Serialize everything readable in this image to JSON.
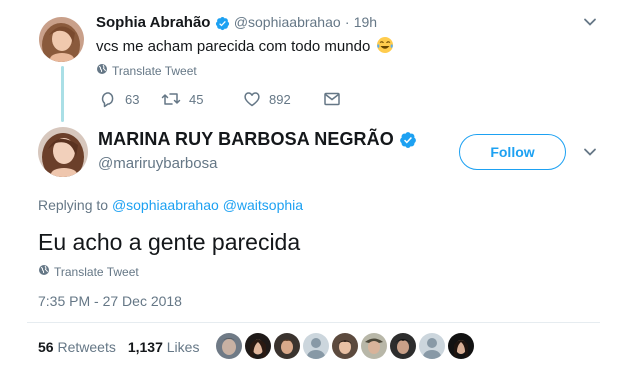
{
  "parent_tweet": {
    "author_name": "Sophia Abrahão",
    "author_handle": "@sophiaabrahao",
    "separator": "·",
    "time": "19h",
    "text": "vcs me acham parecida com todo mundo",
    "emoji": "face-with-tears-of-joy",
    "translate_label": "Translate Tweet",
    "replies": "63",
    "retweets": "45",
    "likes": "892"
  },
  "main_tweet": {
    "author_name": "MARINA RUY BARBOSA NEGRÃO",
    "author_handle": "@mariruybarbosa",
    "follow_label": "Follow",
    "replying_prefix": "Replying to",
    "reply_mentions": [
      "@sophiaabrahao",
      "@waitsophia"
    ],
    "text": "Eu acho a gente parecida",
    "translate_label": "Translate Tweet",
    "timestamp": "7:35 PM - 27 Dec 2018",
    "retweet_count": "56",
    "retweet_label": "Retweets",
    "like_count": "1,137",
    "like_label": "Likes"
  },
  "colors": {
    "accent": "#1da1f2",
    "text_primary": "#14171a",
    "text_secondary": "#657786",
    "thread_line": "#aadfe6",
    "divider": "#e6ecf0"
  },
  "icons": {
    "verified": "verified-badge-icon",
    "reply": "reply-icon",
    "retweet": "retweet-icon",
    "like": "heart-icon",
    "dm": "envelope-icon",
    "translate": "globe-icon",
    "more": "chevron-down-icon"
  },
  "liker_avatar_count": 9
}
